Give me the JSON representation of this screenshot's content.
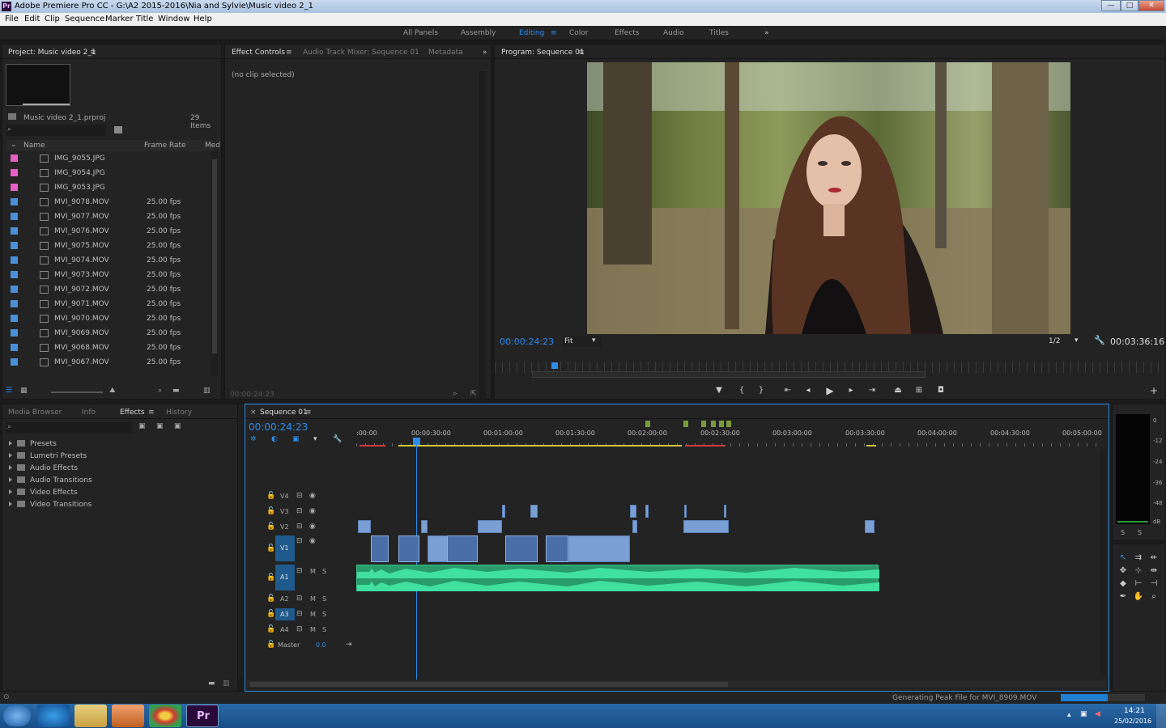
{
  "window": {
    "title": "Adobe Premiere Pro CC - G:\\A2 2015-2016\\Nia and Sylvie\\Music video 2_1",
    "logo": "Pr",
    "minimize": "—",
    "maximize": "□",
    "close": "✕"
  },
  "menu": [
    "File",
    "Edit",
    "Clip",
    "Sequence",
    "Marker",
    "Title",
    "Window",
    "Help"
  ],
  "workspaces": {
    "items": [
      "All Panels",
      "Assembly",
      "Editing",
      "Color",
      "Effects",
      "Audio",
      "Titles"
    ],
    "active": "Editing",
    "more": "»"
  },
  "project": {
    "tab": "Project: Music video 2_1",
    "file": "Music video 2_1.prproj",
    "count": "29 Items",
    "columns": {
      "name": "Name",
      "frame_rate": "Frame Rate",
      "media": "Med"
    },
    "items": [
      {
        "name": "IMG_9055.JPG",
        "fps": "",
        "color": "#e85fc8"
      },
      {
        "name": "IMG_9054.JPG",
        "fps": "",
        "color": "#e85fc8"
      },
      {
        "name": "IMG_9053.JPG",
        "fps": "",
        "color": "#e85fc8"
      },
      {
        "name": "MVI_9078.MOV",
        "fps": "25.00 fps",
        "color": "#4a90d9"
      },
      {
        "name": "MVI_9077.MOV",
        "fps": "25.00 fps",
        "color": "#4a90d9"
      },
      {
        "name": "MVI_9076.MOV",
        "fps": "25.00 fps",
        "color": "#4a90d9"
      },
      {
        "name": "MVI_9075.MOV",
        "fps": "25.00 fps",
        "color": "#4a90d9"
      },
      {
        "name": "MVI_9074.MOV",
        "fps": "25.00 fps",
        "color": "#4a90d9"
      },
      {
        "name": "MVI_9073.MOV",
        "fps": "25.00 fps",
        "color": "#4a90d9"
      },
      {
        "name": "MVI_9072.MOV",
        "fps": "25.00 fps",
        "color": "#4a90d9"
      },
      {
        "name": "MVI_9071.MOV",
        "fps": "25.00 fps",
        "color": "#4a90d9"
      },
      {
        "name": "MVI_9070.MOV",
        "fps": "25.00 fps",
        "color": "#4a90d9"
      },
      {
        "name": "MVI_9069.MOV",
        "fps": "25.00 fps",
        "color": "#4a90d9"
      },
      {
        "name": "MVI_9068.MOV",
        "fps": "25.00 fps",
        "color": "#4a90d9"
      },
      {
        "name": "MVI_9067.MOV",
        "fps": "25.00 fps",
        "color": "#4a90d9"
      }
    ]
  },
  "effect_controls": {
    "tabs": [
      "Effect Controls",
      "Audio Track Mixer: Sequence 01",
      "Metadata"
    ],
    "no_clip": "(no clip selected)",
    "timecode": "00:00:24:23"
  },
  "program": {
    "tab": "Program: Sequence 01",
    "timecode": "00:00:24:23",
    "fit": "Fit",
    "resolution": "1/2",
    "duration": "00:03:36:16"
  },
  "effects_panel": {
    "tabs": [
      "Media Browser",
      "Info",
      "Effects",
      "History"
    ],
    "active": "Effects",
    "folders": [
      "Presets",
      "Lumetri Presets",
      "Audio Effects",
      "Audio Transitions",
      "Video Effects",
      "Video Transitions"
    ]
  },
  "timeline": {
    "tab": "Sequence 01",
    "timecode": "00:00:24:23",
    "ruler": [
      ":00:00",
      "00:00:30:00",
      "00:01:00:00",
      "00:01:30:00",
      "00:02:00:00",
      "00:02:30:00",
      "00:03:00:00",
      "00:03:30:00",
      "00:04:00:00",
      "00:04:30:00",
      "00:05:00:00"
    ],
    "video_tracks": [
      "V4",
      "V3",
      "V2",
      "V1"
    ],
    "audio_tracks": [
      "A1",
      "A2",
      "A3",
      "A4"
    ],
    "master": "Master",
    "master_value": "0.0",
    "mute": "M",
    "solo": "S"
  },
  "meter": {
    "labels": [
      "0",
      "-12",
      "-24",
      "-36",
      "-48",
      "dB"
    ],
    "solo": [
      "S",
      "S"
    ]
  },
  "status": {
    "message": "Generating Peak File for MVI_8909.MOV"
  },
  "taskbar": {
    "time": "14:21",
    "date": "25/02/2016",
    "premiere": "Pr"
  }
}
